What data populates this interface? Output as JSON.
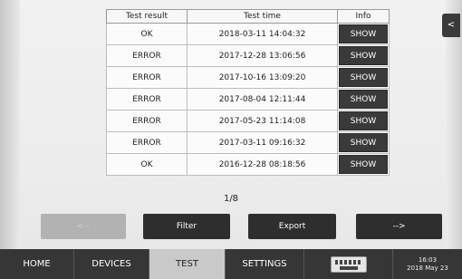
{
  "table": {
    "headers": {
      "result": "Test result",
      "time": "Test time",
      "info": "Info"
    },
    "rows": [
      {
        "result": "OK",
        "time": "2018-03-11 14:04:32",
        "info": "SHOW"
      },
      {
        "result": "ERROR",
        "time": "2017-12-28 13:06:56",
        "info": "SHOW"
      },
      {
        "result": "ERROR",
        "time": "2017-10-16 13:09:20",
        "info": "SHOW"
      },
      {
        "result": "ERROR",
        "time": "2017-08-04 12:11:44",
        "info": "SHOW"
      },
      {
        "result": "ERROR",
        "time": "2017-05-23 11:14:08",
        "info": "SHOW"
      },
      {
        "result": "ERROR",
        "time": "2017-03-11 09:16:32",
        "info": "SHOW"
      },
      {
        "result": "OK",
        "time": "2016-12-28 08:18:56",
        "info": "SHOW"
      }
    ]
  },
  "side_tab": {
    "label": "<"
  },
  "pager": {
    "text": "1/8"
  },
  "actions": {
    "prev": "<--",
    "filter": "Filter",
    "export": "Export",
    "next": "-->"
  },
  "nav": {
    "home": "HOME",
    "devices": "DEVICES",
    "test": "TEST",
    "settings": "SETTINGS",
    "keyboard_icon": "keyboard-icon",
    "clock_time": "16:03",
    "clock_date": "2018 May 23"
  },
  "colors": {
    "ok": "#2f9a2f",
    "error": "#e04040",
    "dark": "#363636",
    "active_tab": "#c9c9c9"
  }
}
